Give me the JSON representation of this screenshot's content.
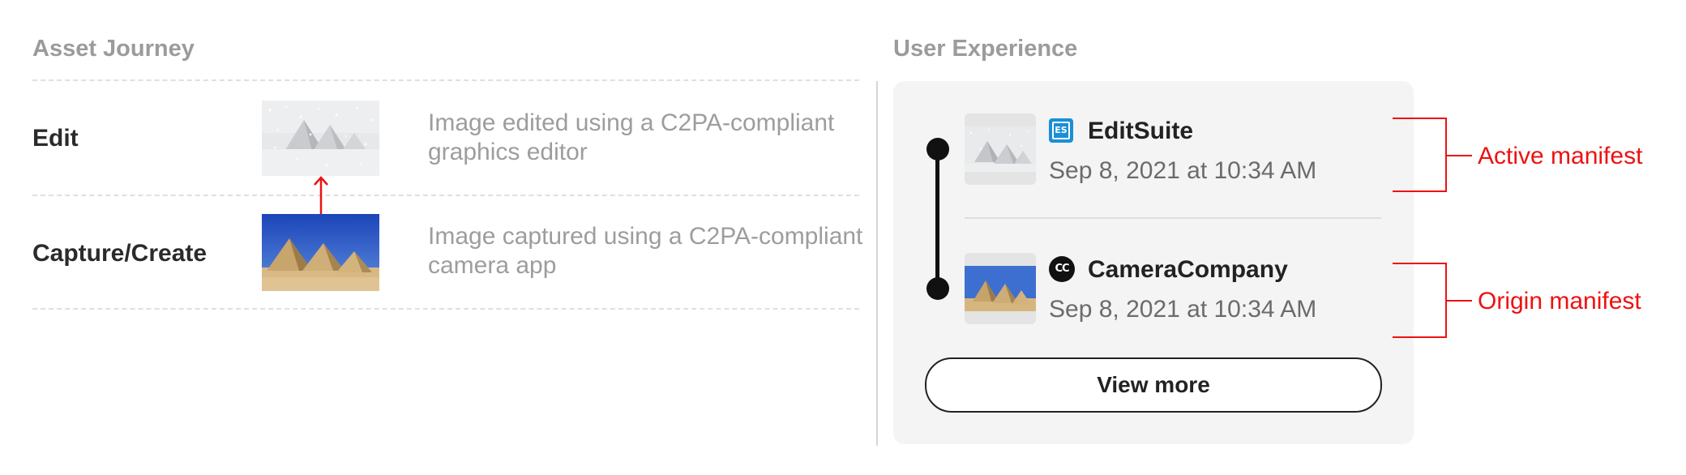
{
  "asset_journey": {
    "title": "Asset Journey",
    "steps": [
      {
        "label": "Edit",
        "description": "Image edited using a C2PA-compliant graphics editor",
        "thumbnail": "snowy-pyramids-image"
      },
      {
        "label": "Capture/Create",
        "description": "Image captured using a C2PA-compliant camera app",
        "thumbnail": "pyramids-image"
      }
    ],
    "arrow_color": "#ee1111"
  },
  "user_experience": {
    "title": "User Experience",
    "entries": [
      {
        "app_name": "EditSuite",
        "app_icon": "es-app-icon",
        "app_icon_text": "ES",
        "date": "Sep 8, 2021 at 10:34 AM",
        "thumbnail": "snowy-pyramids-image"
      },
      {
        "app_name": "CameraCompany",
        "app_icon": "cc-app-icon",
        "app_icon_text": "CC",
        "date": "Sep 8, 2021 at 10:34 AM",
        "thumbnail": "pyramids-image"
      }
    ],
    "view_more_label": "View more"
  },
  "annotations": {
    "color": "#ee1111",
    "active": "Active manifest",
    "origin": "Origin manifest"
  }
}
